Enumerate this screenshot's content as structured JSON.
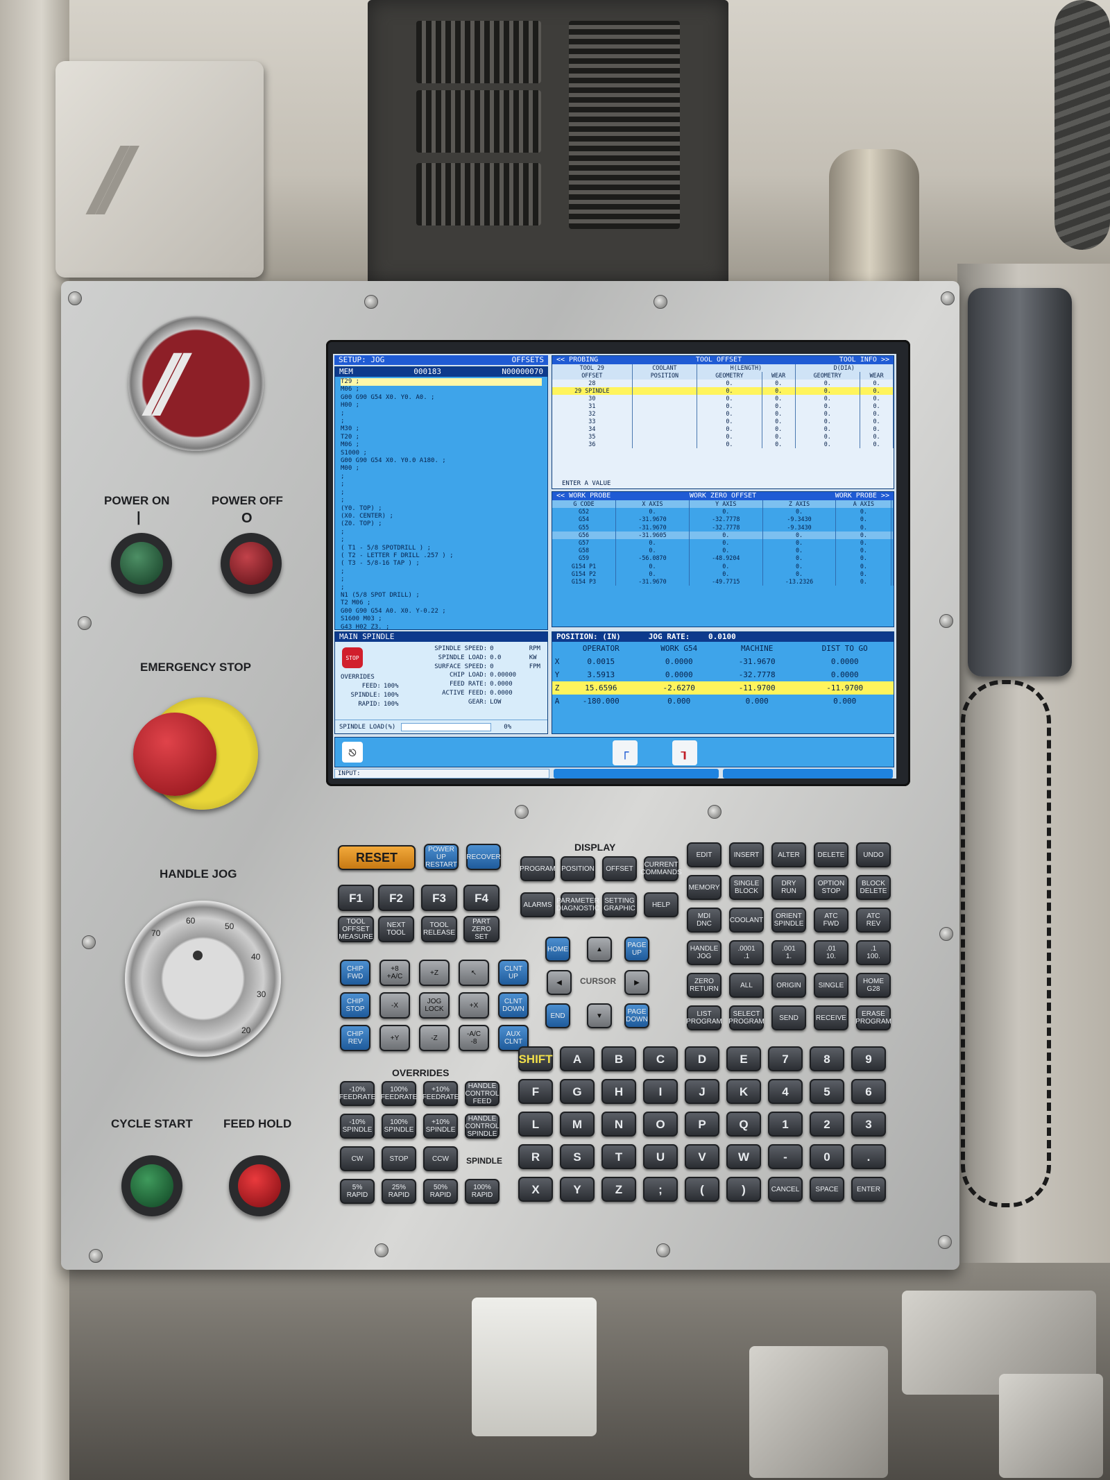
{
  "setup_bar": {
    "left": "SETUP: JOG",
    "right": "OFFSETS"
  },
  "program": {
    "mode": "MEM",
    "prog_no": "000183",
    "seq_no": "N00000070",
    "lines": [
      "T29 ;",
      "M06 ;",
      "G00 G90 G54 X0. Y0. A0. ;",
      "H00 ;",
      ";",
      ";",
      "M30 ;",
      "T20 ;",
      "M06 ;",
      "S1000 ;",
      "G00 G90 G54 X0. Y0.0 A180. ;",
      "M00 ;",
      ";",
      ";",
      ";",
      ";",
      "(Y0. TOP) ;",
      "(X0. CENTER) ;",
      "(Z0. TOP) ;",
      ";",
      ";",
      "( T1 - 5/8 SPOTDRILL ) ;",
      "( T2 - LETTER F DRILL .257 ) ;",
      "( T3 - 5/8-16 TAP ) ;",
      ";",
      ";",
      ";",
      "N1 (5/8 SPOT DRILL) ;",
      "T2 M06 ;",
      "G00 G90 G54 A0. X0. Y-0.22 ;",
      "S1600 M03 ;",
      "G43 H02 Z3. ;"
    ]
  },
  "tool_offset": {
    "tabs": {
      "left": "<< PROBING",
      "center": "TOOL OFFSET",
      "right": "TOOL INFO >>"
    },
    "tool_label": "TOOL",
    "tool_no": "29",
    "coolant_label": "COOLANT",
    "h_label": "H(LENGTH)",
    "d_label": "D(DIA)",
    "columns": [
      "OFFSET",
      "POSITION",
      "GEOMETRY",
      "WEAR",
      "GEOMETRY",
      "WEAR"
    ],
    "rows": [
      [
        "28",
        "",
        "0.",
        "0.",
        "0.",
        "0."
      ],
      [
        "29 SPINDLE",
        "",
        "0.",
        "0.",
        "0.",
        "0."
      ],
      [
        "30",
        "",
        "0.",
        "0.",
        "0.",
        "0."
      ],
      [
        "31",
        "",
        "0.",
        "0.",
        "0.",
        "0."
      ],
      [
        "32",
        "",
        "0.",
        "0.",
        "0.",
        "0."
      ],
      [
        "33",
        "",
        "0.",
        "0.",
        "0.",
        "0."
      ],
      [
        "34",
        "",
        "0.",
        "0.",
        "0.",
        "0."
      ],
      [
        "35",
        "",
        "0.",
        "0.",
        "0.",
        "0."
      ],
      [
        "36",
        "",
        "0.",
        "0.",
        "0.",
        "0."
      ]
    ],
    "prompt": "ENTER A VALUE"
  },
  "work_offset": {
    "tabs": {
      "left": "<< WORK PROBE",
      "center": "WORK ZERO OFFSET",
      "right": "WORK PROBE >>"
    },
    "columns": [
      "G CODE",
      "X AXIS",
      "Y AXIS",
      "Z AXIS",
      "A AXIS",
      ""
    ],
    "rows": [
      [
        "G52",
        "0.",
        "0.",
        "0.",
        "0.",
        ""
      ],
      [
        "G54",
        "-31.9670",
        "-32.7778",
        "-9.3430",
        "0.",
        ""
      ],
      [
        "G55",
        "-31.9670",
        "-32.7778",
        "-9.3430",
        "0.",
        ""
      ],
      [
        "G56",
        "-31.9605",
        "0.",
        "0.",
        "0.",
        ""
      ],
      [
        "G57",
        "0.",
        "0.",
        "0.",
        "0.",
        ""
      ],
      [
        "G58",
        "0.",
        "0.",
        "0.",
        "0.",
        ""
      ],
      [
        "G59",
        "-56.0870",
        "-48.9204",
        "0.",
        "0.",
        ""
      ],
      [
        "G154 P1",
        "0.",
        "0.",
        "0.",
        "0.",
        ""
      ],
      [
        "G154 P2",
        "0.",
        "0.",
        "0.",
        "0.",
        ""
      ],
      [
        "G154 P3",
        "-31.9670",
        "-49.7715",
        "-13.2326",
        "0.",
        ""
      ]
    ]
  },
  "spindle": {
    "title": "MAIN SPINDLE",
    "stop_label": "STOP",
    "overrides_label": "OVERRIDES",
    "overrides": [
      [
        "FEED:",
        "100%"
      ],
      [
        "SPINDLE:",
        "100%"
      ],
      [
        "RAPID:",
        "100%"
      ]
    ],
    "stats": [
      [
        "SPINDLE SPEED:",
        "0",
        "RPM"
      ],
      [
        "SPINDLE LOAD:",
        "0.0",
        "KW"
      ],
      [
        "SURFACE SPEED:",
        "0",
        "FPM"
      ],
      [
        "CHIP LOAD:",
        "0.00000",
        ""
      ],
      [
        "FEED RATE:",
        "0.0000",
        ""
      ],
      [
        "ACTIVE FEED:",
        "0.0000",
        ""
      ],
      [
        "GEAR:",
        "LOW",
        ""
      ]
    ],
    "load_label": "SPINDLE LOAD(%)",
    "load_value": "0%",
    "load_fraction": 0
  },
  "position": {
    "title": "POSITION: (IN)",
    "jog_rate_label": "JOG RATE:",
    "jog_rate": "0.0100",
    "columns": [
      "",
      "OPERATOR",
      "WORK  G54",
      "MACHINE",
      "DIST TO GO"
    ],
    "rows": [
      [
        "X",
        "0.0015",
        "0.0000",
        "-31.9670",
        "0.0000"
      ],
      [
        "Y",
        "3.5913",
        "0.0000",
        "-32.7778",
        "0.0000"
      ],
      [
        "Z",
        "15.6596",
        "-2.6270",
        "-11.9700",
        "-11.9700"
      ],
      [
        "A",
        "-180.000",
        "0.000",
        "0.000",
        "0.000"
      ]
    ]
  },
  "input_label": "INPUT:",
  "panel_labels": {
    "power_on": "POWER ON",
    "power_off": "POWER OFF",
    "emergency_stop": "EMERGENCY STOP",
    "handle_jog": "HANDLE JOG",
    "cycle_start": "CYCLE START",
    "feed_hold": "FEED HOLD",
    "display": "DISPLAY",
    "overrides": "OVERRIDES",
    "cursor": "CURSOR",
    "spindle": "SPINDLE",
    "on_symbol": "|",
    "off_symbol": "O"
  },
  "dial_numbers": [
    "70",
    "60",
    "50",
    "40",
    "30",
    "20"
  ],
  "colors": {
    "screen_blue": "#3ea4ea",
    "title_bar": "#0d3a8c",
    "highlight": "#fff45c",
    "reset_key": "#f2a93b"
  }
}
